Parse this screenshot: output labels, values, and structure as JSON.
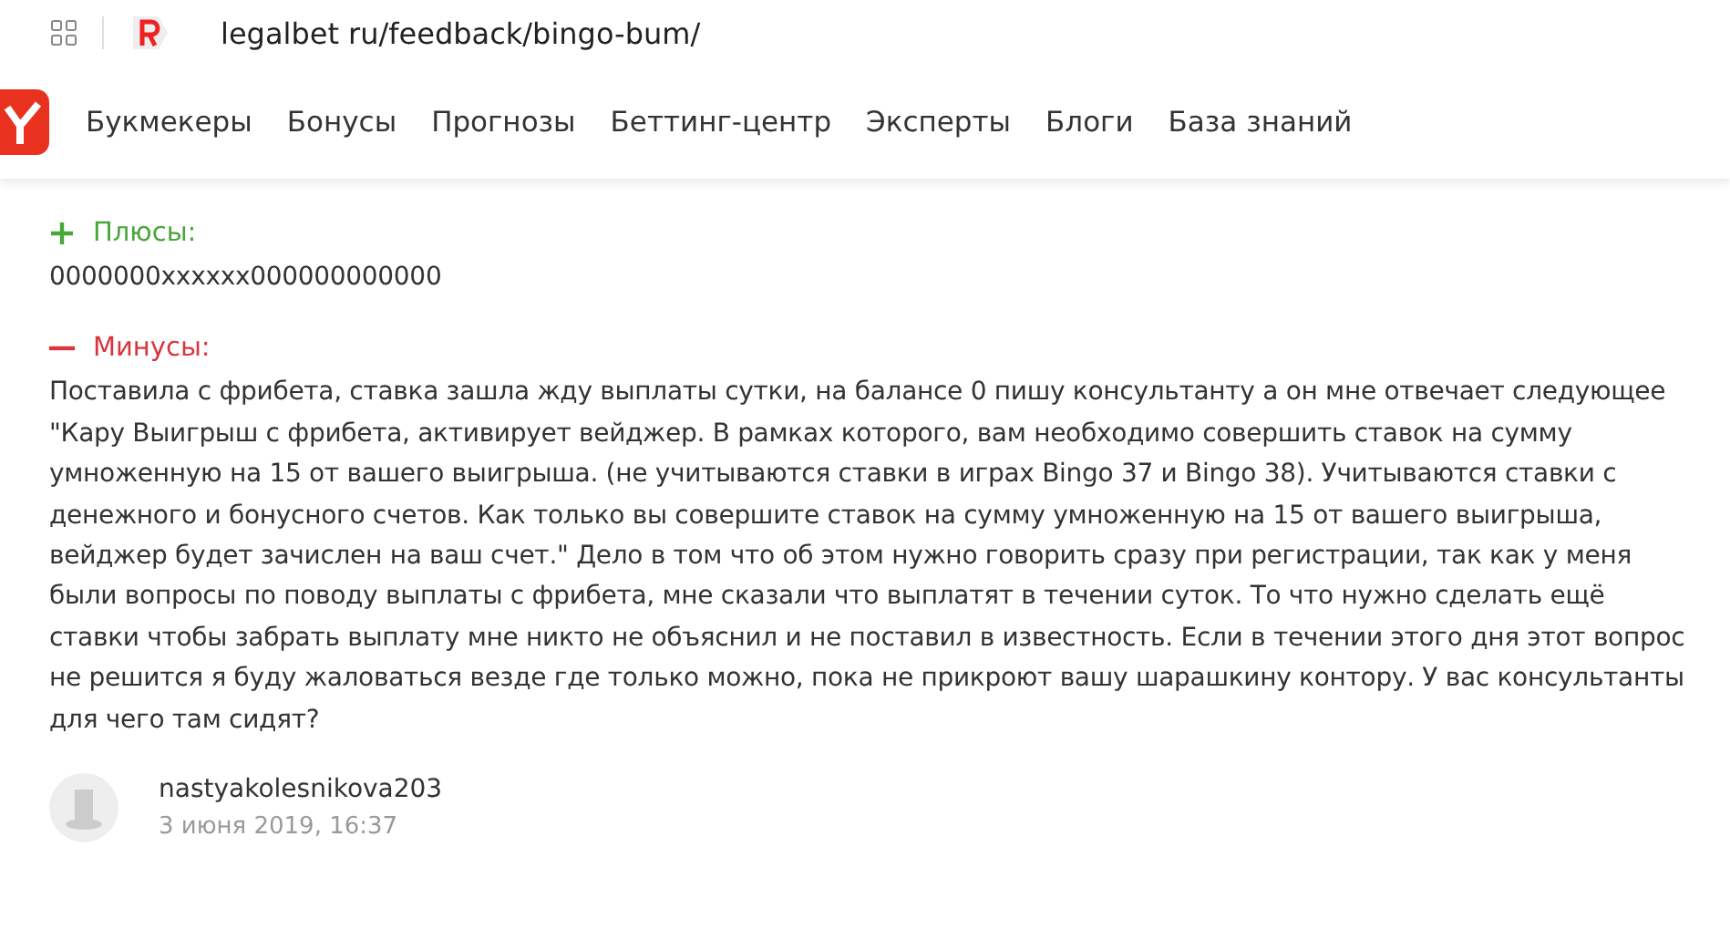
{
  "browser": {
    "address": "legalbet ru/feedback/bingo-bum/"
  },
  "nav": {
    "items": [
      "Букмекеры",
      "Бонусы",
      "Прогнозы",
      "Беттинг-центр",
      "Эксперты",
      "Блоги",
      "База знаний"
    ]
  },
  "sections": [
    {
      "kind": "plus",
      "title": "Плюсы:",
      "text": "0000000xxxxxx000000000000"
    },
    {
      "kind": "minus",
      "title": "Минусы:",
      "text": "Поставила с фрибета, ставка зашла жду выплаты сутки, на балансе 0 пишу консультанту а он мне отвечает следующее \"Кару Выигрыш с фрибета, активирует вейджер. В рамках которого, вам необходимо совершить ставок на сумму умноженную на 15 от вашего выигрыша. (не учитываются ставки в играх Bingo 37 и Bingo 38). Учитываются ставки с денежного и бонусного счетов. Как только вы совершите ставок на сумму умноженную на 15 от вашего выигрыша, вейджер будет зачислен на ваш счет.\" Дело в том что об этом нужно говорить сразу при регистрации, так как у меня были вопросы по поводу выплаты с фрибета, мне сказали что выплатят в течении суток. То что нужно сделать ещё ставки чтобы забрать выплату мне никто не объяснил и не поставил в известность. Если в течении этого дня этот вопрос не решится я буду жаловаться везде где только можно, пока не прикроют вашу шарашкину контору. У вас консультанты для чего там сидят?"
    }
  ],
  "author": {
    "name": "nastyakolesnikova203",
    "date": "3 июня 2019, 16:37"
  }
}
